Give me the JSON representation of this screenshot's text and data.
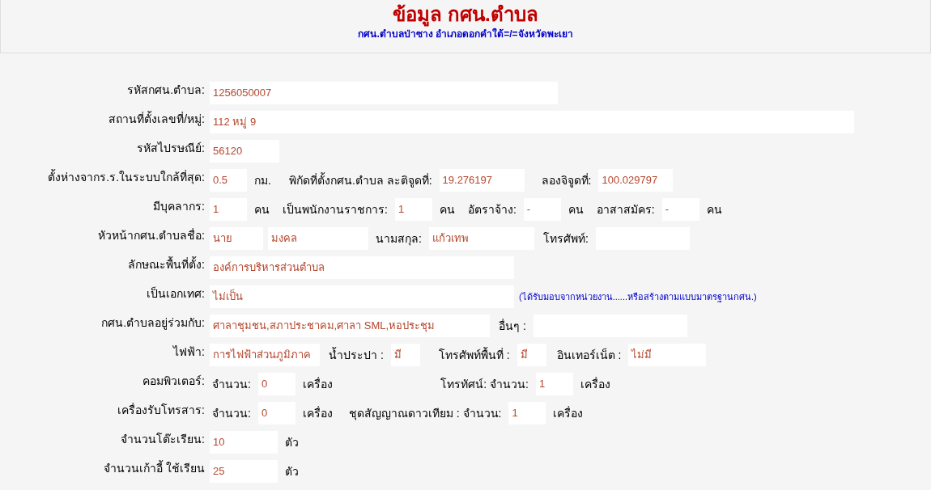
{
  "header": {
    "title": "ข้อมูล กศน.ตำบล",
    "subtitle": "กศน.ตำบลป่าซาง  อำเภอดอกคำใต้=/=จังหวัดพะเยา"
  },
  "rows": [
    {
      "label": "รหัสกศน.ตำบล:",
      "items": [
        {
          "kind": "field",
          "value": "1256050007"
        }
      ]
    },
    {
      "label": "สถานที่ตั้งเลขที่/หมู่:",
      "items": [
        {
          "kind": "field",
          "value": "112 หมู่ 9"
        }
      ]
    },
    {
      "label": "รหัสไปรษณีย์:",
      "items": [
        {
          "kind": "field",
          "value": "56120"
        }
      ]
    },
    {
      "label": "ตั้งห่างจากร.ร.ในระบบใกล้ที่สุด:",
      "items": [
        {
          "kind": "field",
          "value": "0.5"
        },
        {
          "kind": "text",
          "text": "กม."
        },
        {
          "kind": "text",
          "text": "พิกัดที่ตั้งกศน.ตำบล ละติจูดที่:"
        },
        {
          "kind": "field",
          "value": "19.276197"
        },
        {
          "kind": "text",
          "text": "ลองจิจูดที่:"
        },
        {
          "kind": "field",
          "value": "100.029797"
        }
      ]
    },
    {
      "label": "มีบุคลากร:",
      "items": [
        {
          "kind": "field",
          "value": "1"
        },
        {
          "kind": "text",
          "text": "คน"
        },
        {
          "kind": "text",
          "text": "เป็นพนักงานราชการ:"
        },
        {
          "kind": "field",
          "value": "1"
        },
        {
          "kind": "text",
          "text": "คน"
        },
        {
          "kind": "text",
          "text": "อัตราจ้าง:"
        },
        {
          "kind": "field",
          "value": "-"
        },
        {
          "kind": "text",
          "text": "คน"
        },
        {
          "kind": "text",
          "text": "อาสาสมัคร:"
        },
        {
          "kind": "field",
          "value": "-"
        },
        {
          "kind": "text",
          "text": "คน"
        }
      ]
    },
    {
      "label": "หัวหน้ากศน.ตำบลชื่อ:",
      "items": [
        {
          "kind": "field",
          "value": "นาย"
        },
        {
          "kind": "field",
          "value": "มงคล"
        },
        {
          "kind": "text",
          "text": "นามสกุล:"
        },
        {
          "kind": "field",
          "value": "แก้วเทพ"
        },
        {
          "kind": "text",
          "text": "โทรศัพท์:"
        },
        {
          "kind": "field"
        }
      ]
    },
    {
      "label": "ลักษณะพื้นที่ตั้ง:",
      "items": [
        {
          "kind": "field",
          "value": "องค์การบริหารส่วนตำบล"
        }
      ]
    },
    {
      "label": "เป็นเอกเทศ:",
      "items": [
        {
          "kind": "field",
          "value": "ไม่เป็น"
        },
        {
          "kind": "note",
          "text": "(ได้รับมอบจากหน่วยงาน......หรือสร้างตามแบบมาตรฐานกศน.)"
        }
      ]
    },
    {
      "label": "กศน.ตำบลอยู่ร่วมกับ:",
      "items": [
        {
          "kind": "field",
          "value": "ศาลาชุมชน,สภาประชาคม,ศาลา SML,หอประชุม"
        },
        {
          "kind": "text",
          "text": "อื่นๆ :"
        },
        {
          "kind": "field"
        }
      ]
    },
    {
      "label": "ไฟฟ้า:",
      "items": [
        {
          "kind": "field",
          "value": "การไฟฟ้าส่วนภูมิภาค"
        },
        {
          "kind": "text",
          "text": "น้ำประปา :"
        },
        {
          "kind": "field",
          "value": "มี"
        },
        {
          "kind": "text",
          "text": "โทรศัพท์พื้นที่ :"
        },
        {
          "kind": "field",
          "value": "มี"
        },
        {
          "kind": "text",
          "text": "อินเทอร์เน็ต :"
        },
        {
          "kind": "field",
          "value": "ไม่มี"
        }
      ]
    },
    {
      "label": "คอมพิวเตอร์:",
      "items": [
        {
          "kind": "text",
          "text": "จำนวน:"
        },
        {
          "kind": "field",
          "value": "0"
        },
        {
          "kind": "text",
          "text": "เครื่อง"
        },
        {
          "kind": "text",
          "text": "โทรทัศน์: จำนวน:"
        },
        {
          "kind": "field",
          "value": "1"
        },
        {
          "kind": "text",
          "text": "เครื่อง"
        }
      ]
    },
    {
      "label": "เครื่องรับโทรสาร:",
      "items": [
        {
          "kind": "text",
          "text": "จำนวน:"
        },
        {
          "kind": "field",
          "value": "0"
        },
        {
          "kind": "text",
          "text": "เครื่อง"
        },
        {
          "kind": "text",
          "text": "ชุดสัญญาณดาวเทียม :  จำนวน:"
        },
        {
          "kind": "field",
          "value": "1"
        },
        {
          "kind": "text",
          "text": "เครื่อง"
        }
      ]
    },
    {
      "label": "จำนวนโต๊ะเรียน:",
      "items": [
        {
          "kind": "field",
          "value": "10"
        },
        {
          "kind": "text",
          "text": "ตัว"
        }
      ]
    },
    {
      "label": "จำนวนเก้าอี้ ใช้เรียน",
      "items": [
        {
          "kind": "field",
          "value": "25"
        },
        {
          "kind": "text",
          "text": "ตัว"
        }
      ]
    }
  ]
}
